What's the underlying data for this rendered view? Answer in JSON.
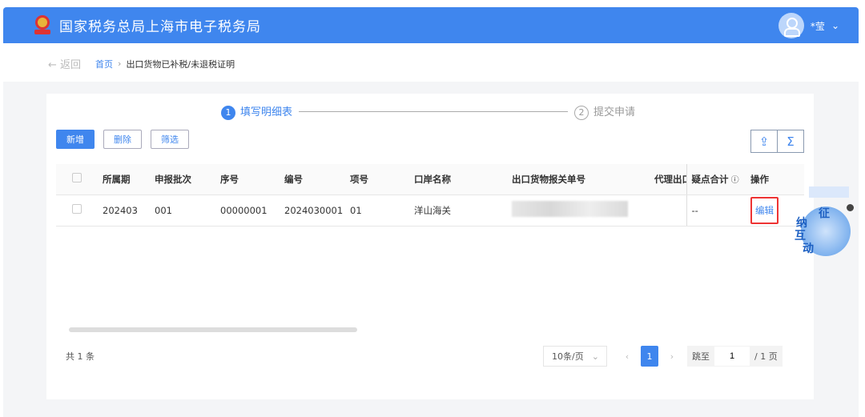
{
  "header": {
    "title": "国家税务总局上海市电子税务局",
    "user": "",
    "user_name": "*莹"
  },
  "breadcrumb": {
    "back": "← 返回",
    "home": "首页",
    "separator": "›",
    "current": "出口货物已补税/未退税证明"
  },
  "steps": [
    {
      "num": "1",
      "label": "填写明细表",
      "active": true
    },
    {
      "num": "2",
      "label": "提交申请",
      "active": false
    }
  ],
  "toolbar": {
    "add": "新增",
    "delete": "删除",
    "filter": "筛选",
    "export_icon": "export-icon",
    "sum_icon": "Σ"
  },
  "table": {
    "columns": [
      "所属期",
      "申报批次",
      "序号",
      "编号",
      "项号",
      "口岸名称",
      "出口货物报关单号",
      "代理出口",
      "疑点合计",
      "操作"
    ],
    "rows": [
      {
        "period": "202403",
        "batch": "001",
        "seq": "00000001",
        "code": "2024030001",
        "item": "01",
        "port": "洋山海关",
        "customs_no": "",
        "doubt": "--",
        "action": "编辑"
      }
    ]
  },
  "footer": {
    "total": "共 1 条",
    "page_size": "10条/页",
    "current_page": "1",
    "jump_label": "跳至",
    "jump_value": "1",
    "page_total": "/ 1 页"
  },
  "assistant": {
    "chars": [
      "征",
      "纳",
      "互",
      "动"
    ]
  },
  "colors": {
    "primary": "#3f86ee",
    "highlight": "#e33333"
  }
}
